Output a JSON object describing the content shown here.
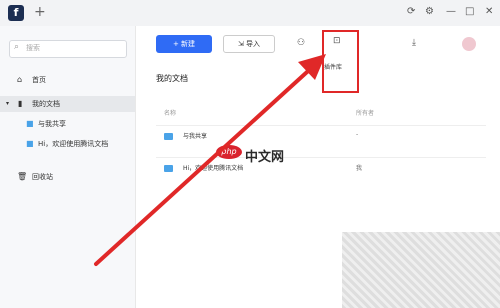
{
  "topbar": {
    "logo_text": "f",
    "new_tab": "+",
    "controls": [
      "⟳",
      "⚙",
      "—",
      "□",
      "✕"
    ]
  },
  "sidebar": {
    "search_placeholder": "搜索",
    "items": [
      {
        "label": "首页",
        "icon": "home-icon"
      },
      {
        "label": "我的文档",
        "icon": "document-icon"
      },
      {
        "label": "与我共享",
        "icon": "folder-icon"
      },
      {
        "label": "Hi，欢迎使用腾讯文档",
        "icon": "folder-icon"
      },
      {
        "label": "回收站",
        "icon": "trash-icon"
      }
    ]
  },
  "toolbar": {
    "new_label": "+ 新建",
    "import_label": "导入",
    "plugin_tooltip": "插件库"
  },
  "main": {
    "title": "我的文档",
    "columns": {
      "name": "名称",
      "owner": "所有者"
    },
    "rows": [
      {
        "name": "与我共享",
        "owner": "-"
      },
      {
        "name": "Hi，欢迎使用腾讯文档",
        "owner": "我"
      }
    ]
  },
  "watermark": {
    "logo": "php",
    "text": "中文网"
  },
  "colors": {
    "accent": "#2f6bf5",
    "highlight": "#e02828",
    "folder": "#4aa3e8"
  }
}
